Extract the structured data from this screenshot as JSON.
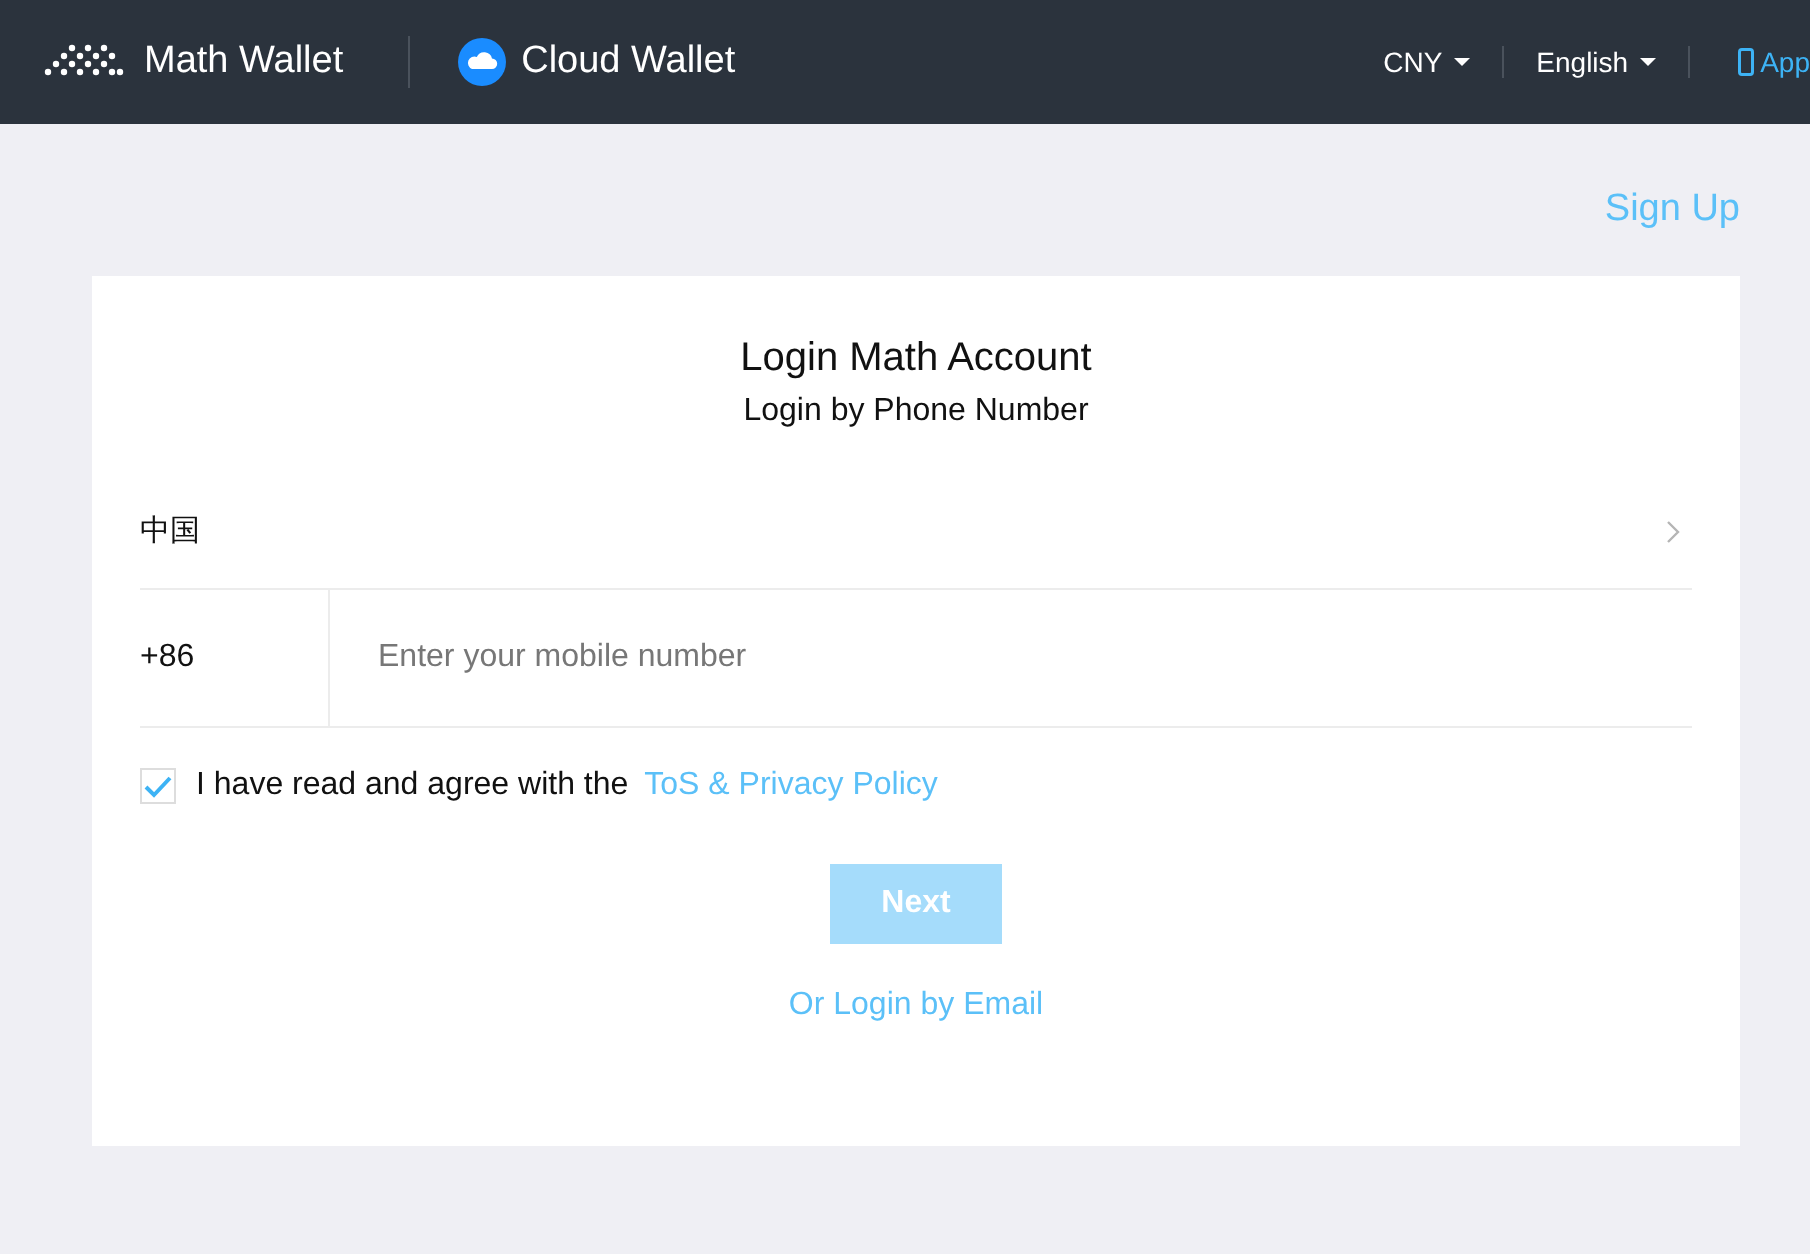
{
  "header": {
    "brand": "Math Wallet",
    "product": "Cloud Wallet",
    "currency": "CNY",
    "language": "English",
    "app_link": "App"
  },
  "sign_up": "Sign Up",
  "card": {
    "title": "Login Math Account",
    "subtitle": "Login by Phone Number",
    "country": "中国",
    "dial_code": "+86",
    "phone": {
      "placeholder": "Enter your mobile number"
    },
    "agree": {
      "checked": true,
      "text": "I have read and agree with the",
      "link": "ToS & Privacy Policy"
    },
    "next": {
      "label": "Next",
      "disabled": true
    },
    "alt_login": "Or Login by Email"
  }
}
